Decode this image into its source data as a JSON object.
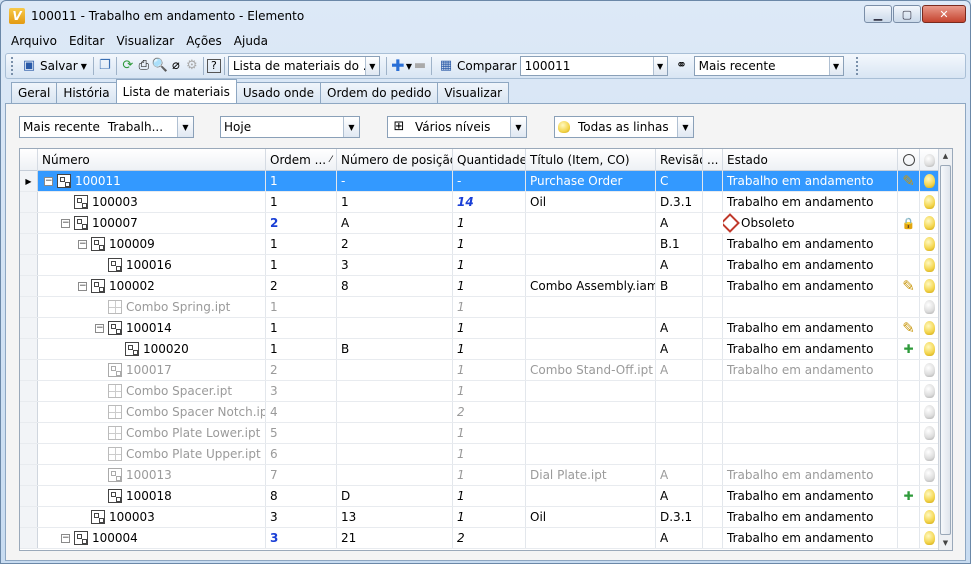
{
  "window": {
    "title": "100011 - Trabalho em andamento - Elemento",
    "app_icon": "V"
  },
  "menu": [
    "Arquivo",
    "Editar",
    "Visualizar",
    "Ações",
    "Ajuda"
  ],
  "toolbar": {
    "save_label": "Salvar",
    "view_combo": "Lista de materiais do ...",
    "compare_label": "Comparar",
    "compare_value": "100011",
    "version_combo": "Mais recente"
  },
  "tabs": [
    "Geral",
    "História",
    "Lista de materiais",
    "Usado onde",
    "Ordem do pedido",
    "Visualizar"
  ],
  "filters": {
    "version": "Mais recente",
    "state": "Trabalh...",
    "date": "Hoje",
    "levels": "Vários níveis",
    "lines": "Todas as linhas"
  },
  "columns": [
    "Número",
    "Ordem ...",
    "Número de posição",
    "Quantidade",
    "Título (Item, CO)",
    "Revisão",
    "...",
    "Estado"
  ],
  "rows": [
    {
      "num": "100011",
      "ord": "1",
      "pos": "-",
      "qty": "-",
      "title": "Purchase Order",
      "rev": "C",
      "state": "Trabalho em andamento"
    },
    {
      "num": "100003",
      "ord": "1",
      "pos": "1",
      "qty": "14",
      "title": "Oil",
      "rev": "D.3.1",
      "state": "Trabalho em andamento"
    },
    {
      "num": "100007",
      "ord": "2",
      "pos": "A",
      "qty": "1",
      "title": "",
      "rev": "A",
      "state": "Obsoleto"
    },
    {
      "num": "100009",
      "ord": "1",
      "pos": "2",
      "qty": "1",
      "title": "",
      "rev": "B.1",
      "state": "Trabalho em andamento"
    },
    {
      "num": "100016",
      "ord": "1",
      "pos": "3",
      "qty": "1",
      "title": "",
      "rev": "A",
      "state": "Trabalho em andamento"
    },
    {
      "num": "100002",
      "ord": "2",
      "pos": "8",
      "qty": "1",
      "title": "Combo Assembly.iam",
      "rev": "B",
      "state": "Trabalho em andamento"
    },
    {
      "num": "Combo Spring.ipt",
      "ord": "1",
      "pos": "",
      "qty": "1",
      "title": "",
      "rev": "",
      "state": ""
    },
    {
      "num": "100014",
      "ord": "1",
      "pos": "",
      "qty": "1",
      "title": "",
      "rev": "A",
      "state": "Trabalho em andamento"
    },
    {
      "num": "100020",
      "ord": "1",
      "pos": "B",
      "qty": "1",
      "title": "",
      "rev": "A",
      "state": "Trabalho em andamento"
    },
    {
      "num": "100017",
      "ord": "2",
      "pos": "",
      "qty": "1",
      "title": "Combo Stand-Off.ipt",
      "rev": "A",
      "state": "Trabalho em andamento"
    },
    {
      "num": "Combo Spacer.ipt",
      "ord": "3",
      "pos": "",
      "qty": "1",
      "title": "",
      "rev": "",
      "state": ""
    },
    {
      "num": "Combo Spacer Notch.ipt",
      "ord": "4",
      "pos": "",
      "qty": "2",
      "title": "",
      "rev": "",
      "state": ""
    },
    {
      "num": "Combo Plate Lower.ipt",
      "ord": "5",
      "pos": "",
      "qty": "1",
      "title": "",
      "rev": "",
      "state": ""
    },
    {
      "num": "Combo Plate Upper.ipt",
      "ord": "6",
      "pos": "",
      "qty": "1",
      "title": "",
      "rev": "",
      "state": ""
    },
    {
      "num": "100013",
      "ord": "7",
      "pos": "",
      "qty": "1",
      "title": "Dial Plate.ipt",
      "rev": "A",
      "state": "Trabalho em andamento"
    },
    {
      "num": "100018",
      "ord": "8",
      "pos": "D",
      "qty": "1",
      "title": "",
      "rev": "A",
      "state": "Trabalho em andamento"
    },
    {
      "num": "100003",
      "ord": "3",
      "pos": "13",
      "qty": "1",
      "title": "Oil",
      "rev": "D.3.1",
      "state": "Trabalho em andamento"
    },
    {
      "num": "100004",
      "ord": "3",
      "pos": "21",
      "qty": "2",
      "title": "",
      "rev": "A",
      "state": "Trabalho em andamento"
    }
  ],
  "colors": {
    "selection": "#3399ff",
    "highlight_number": "#1a3fd6",
    "gray_text": "#9a9a9a"
  }
}
